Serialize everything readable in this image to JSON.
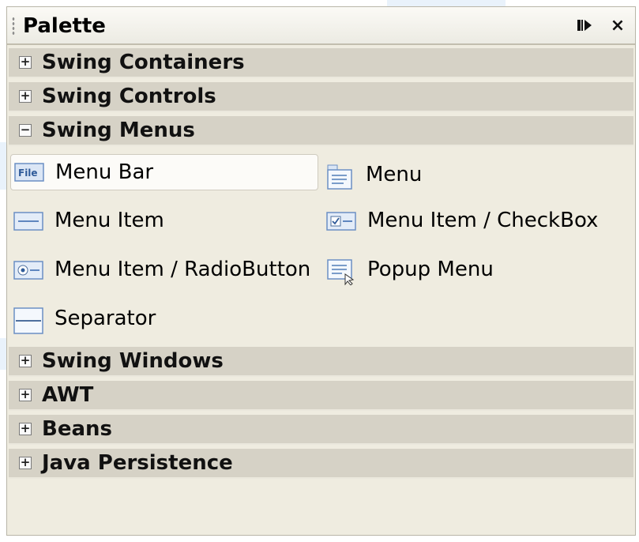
{
  "palette": {
    "title": "Palette",
    "minimize_icon": "minimize-icon",
    "close_label": "×"
  },
  "categories": [
    {
      "label": "Swing Containers",
      "expanded": false,
      "toggle": "+"
    },
    {
      "label": "Swing Controls",
      "expanded": false,
      "toggle": "+"
    },
    {
      "label": "Swing Menus",
      "expanded": true,
      "toggle": "−"
    },
    {
      "label": "Swing Windows",
      "expanded": false,
      "toggle": "+"
    },
    {
      "label": "AWT",
      "expanded": false,
      "toggle": "+"
    },
    {
      "label": "Beans",
      "expanded": false,
      "toggle": "+"
    },
    {
      "label": "Java Persistence",
      "expanded": false,
      "toggle": "+"
    }
  ],
  "items": [
    {
      "label": "Menu Bar",
      "icon": "menu-bar-icon",
      "icon_text": "File",
      "selected": true
    },
    {
      "label": "Menu",
      "icon": "menu-icon"
    },
    {
      "label": "Menu Item",
      "icon": "menu-item-icon"
    },
    {
      "label": "Menu Item / CheckBox",
      "icon": "menu-item-checkbox-icon"
    },
    {
      "label": "Menu Item / RadioButton",
      "icon": "menu-item-radiobutton-icon"
    },
    {
      "label": "Popup Menu",
      "icon": "popup-menu-icon"
    },
    {
      "label": "Separator",
      "icon": "separator-icon"
    }
  ],
  "colors": {
    "panel_bg": "#efece0",
    "category_bg": "#d6d2c6",
    "icon_blue": "#3f74b8"
  }
}
